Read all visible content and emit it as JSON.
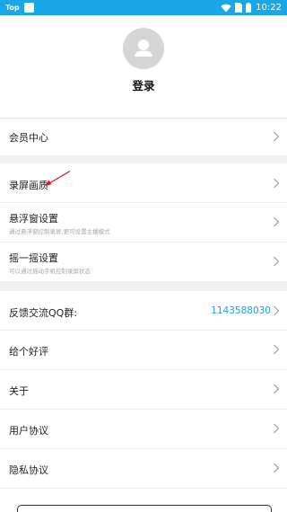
{
  "status_bar": {
    "app_label": "Top",
    "time": "10:22"
  },
  "header": {
    "login_label": "登录"
  },
  "menu": {
    "member_center": "会员中心",
    "record_quality": "录屏画质",
    "floating_window": {
      "label": "悬浮窗设置",
      "sub": "通过悬浮窗控制录屏,更可设置主播模式"
    },
    "shake": {
      "label": "摇一摇设置",
      "sub": "可以通过摇动手机控制录屏状态"
    },
    "feedback": {
      "label": "反馈交流QQ群:",
      "value": "1143588030"
    },
    "rate": "给个好评",
    "about": "关于",
    "user_agreement": "用户协议",
    "privacy": "隐私协议"
  },
  "colors": {
    "status_bar_bg": "#1aa7e8",
    "accent_blue": "#1aa0e6",
    "annotation_arrow": "#e0131b",
    "section_gap": "#f1f1f1"
  },
  "icons": [
    "avatar-person-icon",
    "wifi-icon",
    "sim-icon",
    "battery-icon",
    "chevron-right-icon",
    "annotation-arrow-icon"
  ]
}
